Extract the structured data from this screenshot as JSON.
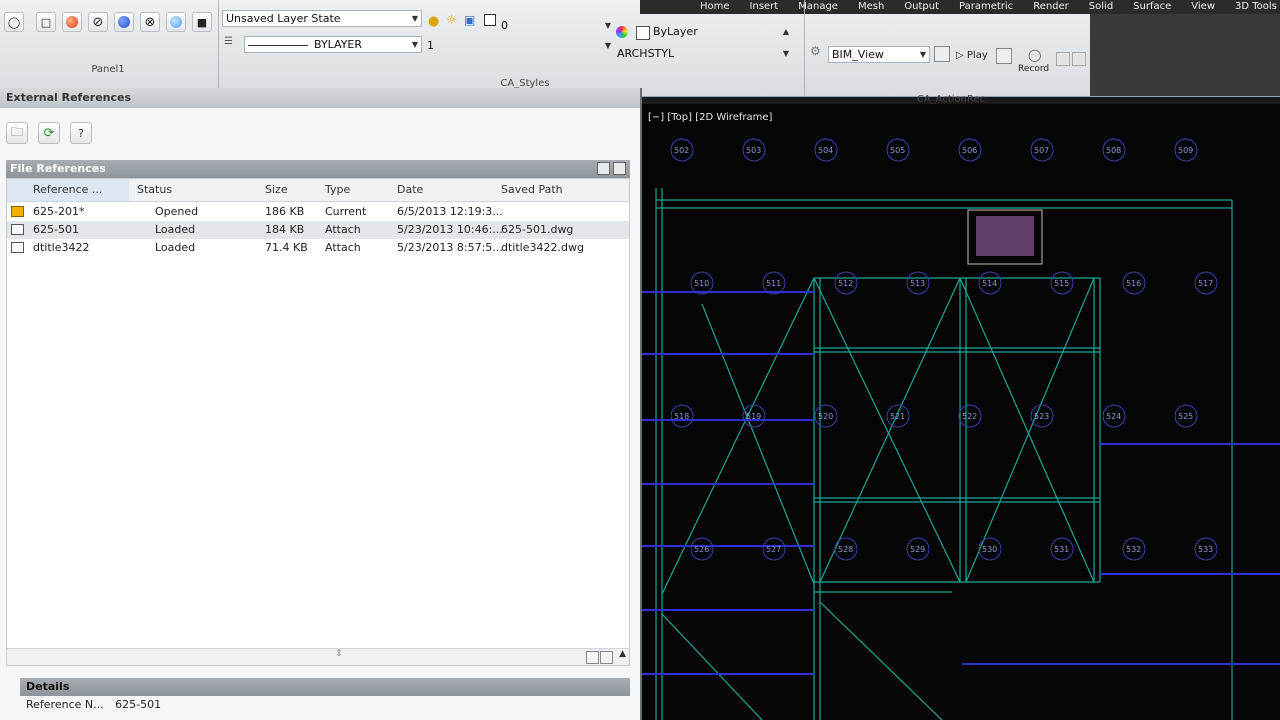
{
  "ribbon": {
    "tabs": [
      "Home",
      "Insert",
      "Manage",
      "Mesh",
      "Output",
      "Parametric",
      "Render",
      "Solid",
      "Surface",
      "View",
      "3D Tools"
    ],
    "panel1_title": "Panel1",
    "ca_styles_title": "CA_Styles",
    "ca_actionrec_title": "CA_ActionRec",
    "layer_state": "Unsaved Layer State",
    "layer_name": "0",
    "linetype": "BYLAYER",
    "lineweight": "1",
    "color": "ByLayer",
    "textstyle": "ARCHSTYL",
    "action_combo": "BIM_View",
    "play_label": "Play",
    "record_label": "Record",
    "colors": {
      "accent": "#2a6fdb",
      "shade_red": "#d93a1a",
      "shade_blue": "#1e50c8",
      "shade_lightblue": "#4aa2ff"
    }
  },
  "xref": {
    "palette_title": "External References",
    "section_title": "File References",
    "columns": [
      "Reference ...",
      "Status",
      "Size",
      "Type",
      "Date",
      "Saved Path"
    ],
    "rows": [
      {
        "name": "625-201*",
        "status": "Opened",
        "size": "186 KB",
        "type": "Current",
        "date": "6/5/2013 12:19:3...",
        "path": ""
      },
      {
        "name": "625-501",
        "status": "Loaded",
        "size": "184 KB",
        "type": "Attach",
        "date": "5/23/2013 10:46:...",
        "path": "625-501.dwg"
      },
      {
        "name": "dtitle3422",
        "status": "Loaded",
        "size": "71.4 KB",
        "type": "Attach",
        "date": "5/23/2013 8:57:5...",
        "path": "dtitle3422.dwg"
      }
    ],
    "details_title": "Details",
    "details_label": "Reference N...",
    "details_value": "625-501"
  },
  "viewport": {
    "label": "[−] [Top] [2D Wireframe]",
    "tags": [
      "502",
      "503",
      "504",
      "505",
      "506",
      "507",
      "508",
      "509",
      "510",
      "511",
      "512",
      "513",
      "514",
      "515",
      "516",
      "517",
      "518",
      "519",
      "520",
      "521",
      "522",
      "523",
      "524",
      "525",
      "526",
      "527",
      "528",
      "529",
      "530",
      "531",
      "532",
      "533"
    ]
  }
}
